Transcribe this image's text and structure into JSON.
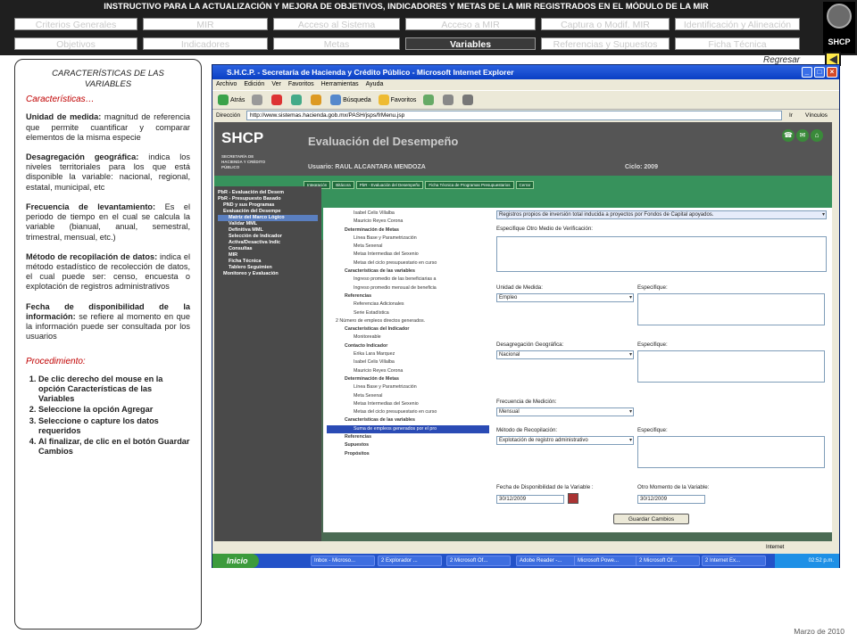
{
  "header": {
    "title": "INSTRUCTIVO PARA  LA ACTUALIZACIÓN Y MEJORA DE OBJETIVOS, INDICADORES Y METAS DE LA MIR REGISTRADOS EN EL MÓDULO DE LA MIR",
    "logo_label": "SHCP",
    "nav_row1": [
      "Criterios Generales",
      "MIR",
      "Acceso al Sistema",
      "Acceso a MIR",
      "Captura o Modif. MIR",
      "Identificación y Alineación"
    ],
    "nav_row2": [
      "Objetivos",
      "Indicadores",
      "Metas",
      "Variables",
      "Referencias y Supuestos",
      "Ficha Técnica"
    ],
    "active_tab": "Variables"
  },
  "regresar": "Regresar",
  "panel": {
    "title": "CARACTERÍSTICAS DE LAS VARIABLES",
    "caracteristicas_heading": "Características…",
    "items": [
      {
        "term": "Unidad de medida:",
        "desc": " magnitud de referencia que permite cuantificar y comparar elementos de la misma especie"
      },
      {
        "term": "Desagregación geográfica:",
        "desc": " indica los niveles territoriales para los que está disponible la variable: nacional, regional, estatal, municipal, etc"
      },
      {
        "term": "Frecuencia de levantamiento:",
        "desc": " Es el periodo de tiempo en el cual se calcula la variable (bianual, anual, semestral, trimestral, mensual, etc.)"
      },
      {
        "term": "Método de recopilación de datos:",
        "desc": " indica el método estadístico de recolección de datos, el cual puede ser: censo, encuesta o explotación de registros administrativos"
      },
      {
        "term": "Fecha de disponibilidad de la información:",
        "desc": " se refiere al momento en que la información puede ser consultada por los usuarios"
      }
    ],
    "procedimiento_heading": "Procedimiento:",
    "steps": [
      "De clic derecho del mouse en la opción Características de las Variables",
      "Seleccione la opción Agregar",
      "Seleccione o capture los datos requeridos",
      "Al finalizar, de clic en el botón Guardar Cambios"
    ]
  },
  "footer_date": "Marzo de 2010",
  "browser": {
    "title": "S.H.C.P. - Secretaría de Hacienda y Crédito Público - Microsoft Internet Explorer",
    "menu": [
      "Archivo",
      "Edición",
      "Ver",
      "Favoritos",
      "Herramientas",
      "Ayuda"
    ],
    "toolbar": [
      "Atrás",
      "Búsqueda",
      "Favoritos"
    ],
    "address_label": "Dirección",
    "address": "http://www.sistemas.hacienda.gob.mx/PASH/jsps/frMenu.jsp",
    "go": "Ir",
    "links": "Vínculos",
    "status": "Internet"
  },
  "app": {
    "logo": "SHCP",
    "subtitle": "SECRETARÍA DE HACIENDA Y CRÉDITO PÚBLICO",
    "heading": "Evaluación del Desempeño",
    "user": "Usuario: RAUL ALCANTARA MENDOZA",
    "ciclo": "Ciclo: 2009",
    "tabs": [
      "Integración",
      "Bitácora",
      "PbR - Evaluación del Desempeño",
      "Ficha Técnica de Programas Presupuestarios",
      "Cerrar"
    ],
    "side_menu": [
      "PbR - Evaluación del Desem",
      "PbR - Presupuesto Basado",
      "PND y sus Programas",
      "Evaluación del Desempe",
      "Matriz del Marco Lógico",
      "Validar MML",
      "Definitiva MML",
      "Selección de Indicador",
      "Activa/Desactiva Indic",
      "Consultas",
      "MIR",
      "Ficha Técnica",
      "Tablero Seguimien",
      "Monitoreo y Evaluación"
    ],
    "tree": [
      "Isabel Celis Villalba",
      "Mauricio Reyes Corona",
      "Determinación de Metas",
      "Línea Base y Parametrización",
      "Meta Sexenal",
      "Metas Intermedias del Sexenio",
      "Metas del ciclo presupuestario en curso",
      "Características de las variables",
      "Ingreso promedio de las beneficiarias a",
      "Ingreso promedio mensual de beneficia",
      "Referencias",
      "Referencias Adicionales",
      "Serie Estadística",
      "2 Número de empleos directos generados.",
      "Características del Indicador",
      "Monitoreable",
      "Contacto Indicador",
      "Erika Lara Marquez",
      "Isabel Celis Villalba",
      "Mauricio Reyes Corona",
      "Determinación de Metas",
      "Línea Base y Parametrización",
      "Meta Sexenal",
      "Metas Intermedias del Sexenio",
      "Metas del ciclo presupuestario en curso",
      "Características de las variables",
      "Suma de empleos generados por el pro",
      "Referencias",
      "Supuestos",
      "Propósitos"
    ],
    "form": {
      "medio_value": "Registros propios de inversión total inducida a proyectos por Fondos de Capital apoyados.",
      "otro_medio_label": "Especifique Otro Medio de Verificación:",
      "unidad_label": "Unidad de Medida:",
      "unidad_value": "Empleo",
      "especifique": "Especifique:",
      "desag_label": "Desagregación Geográfica:",
      "desag_value": "Nacional",
      "frec_label": "Frecuencia de Medición:",
      "frec_value": "Mensual",
      "metodo_label": "Método de Recopilación:",
      "metodo_value": "Explotación de registro administrativo",
      "fecha_label": "Fecha de Disponibilidad de la Variable :",
      "fecha_value": "30/12/2009",
      "otro_momento_label": "Otro Momento de la Variable:",
      "otro_momento_value": "30/12/2009",
      "guardar": "Guardar Cambios"
    }
  },
  "taskbar": {
    "start": "Inicio",
    "items": [
      "Inbox - Microso...",
      "2 Explorador ...",
      "2 Microsoft Of...",
      "Adobe Reader -...",
      "Microsoft Powe...",
      "2 Microsoft Of...",
      "2 Internet Ex..."
    ],
    "clock": "02:52 p.m."
  },
  "colors": {
    "header_bg": "#1f1f1f",
    "accent_red": "#c00000",
    "app_green": "#37925c",
    "taskbar_blue": "#2352c8"
  }
}
